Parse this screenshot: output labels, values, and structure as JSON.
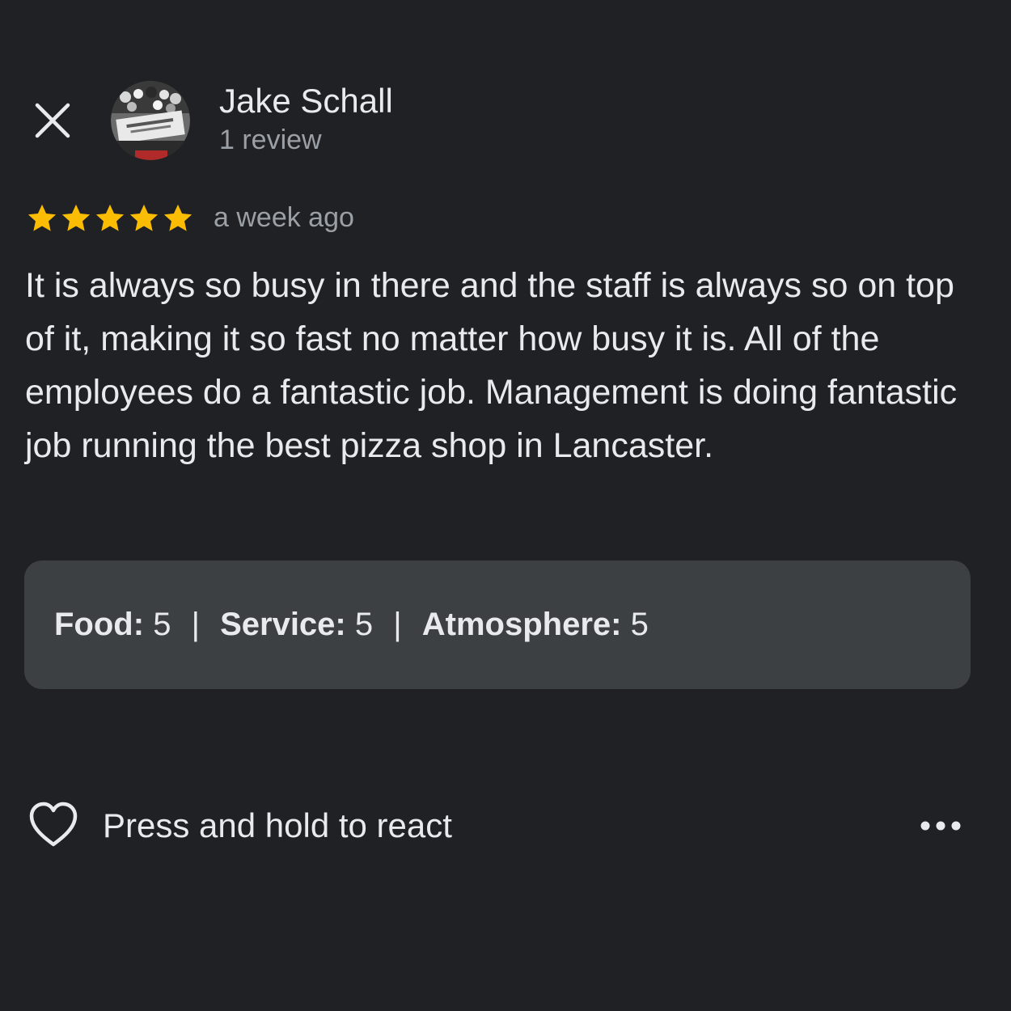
{
  "reviewer": {
    "name": "Jake Schall",
    "review_count": "1 review"
  },
  "review": {
    "rating": 5,
    "rating_max": 5,
    "star_color": "#fbbc04",
    "time_ago": "a week ago",
    "text": "It is always so busy in there and the staff is always so on top of it, making it so fast no matter how busy it is. All of the employees do a fantastic job. Management is doing fantastic job running the best pizza shop in Lancaster."
  },
  "sub_ratings": [
    {
      "label": "Food:",
      "value": "5"
    },
    {
      "label": "Service:",
      "value": "5"
    },
    {
      "label": "Atmosphere:",
      "value": "5"
    }
  ],
  "footer": {
    "react_label": "Press and hold to react"
  },
  "icons": {
    "close": "close-icon",
    "heart": "heart-icon",
    "more": "more-icon",
    "star": "star-icon"
  }
}
